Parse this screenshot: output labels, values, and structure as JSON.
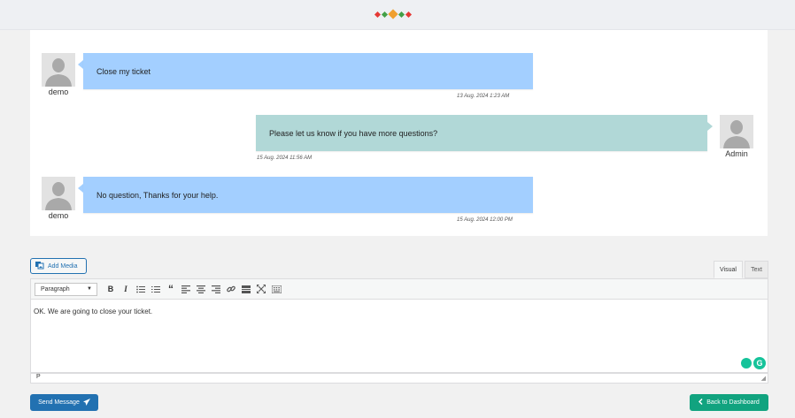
{
  "colors": {
    "bubble_user": "#a3cfff",
    "bubble_admin": "#b1d8d7",
    "send_button": "#2271b1",
    "back_button": "#11a37f",
    "accent_logo": [
      "#e53935",
      "#43a047",
      "#f0a030"
    ]
  },
  "messages": [
    {
      "author": "demo",
      "side": "left",
      "text": "Close my ticket",
      "timestamp": "13 Aug. 2024 1:23 AM"
    },
    {
      "author": "Admin",
      "side": "right",
      "text": "Please let us know if you have more questions?",
      "timestamp": "15 Aug. 2024 11:56 AM"
    },
    {
      "author": "demo",
      "side": "left",
      "text": "No question, Thanks for your help.",
      "timestamp": "15 Aug. 2024 12:00 PM"
    }
  ],
  "editor": {
    "add_media_label": "Add Media",
    "tabs": {
      "visual": "Visual",
      "text": "Text"
    },
    "format_select": "Paragraph",
    "toolbar_icons": [
      "bold-icon",
      "italic-icon",
      "bullet-list-icon",
      "numbered-list-icon",
      "blockquote-icon",
      "align-left-icon",
      "align-center-icon",
      "align-right-icon",
      "link-icon",
      "read-more-icon",
      "fullscreen-icon",
      "toolbar-toggle-icon"
    ],
    "content": "OK. We are going to close your ticket.",
    "path": "P"
  },
  "actions": {
    "send_label": "Send Message",
    "back_label": "Back to Dashboard"
  }
}
